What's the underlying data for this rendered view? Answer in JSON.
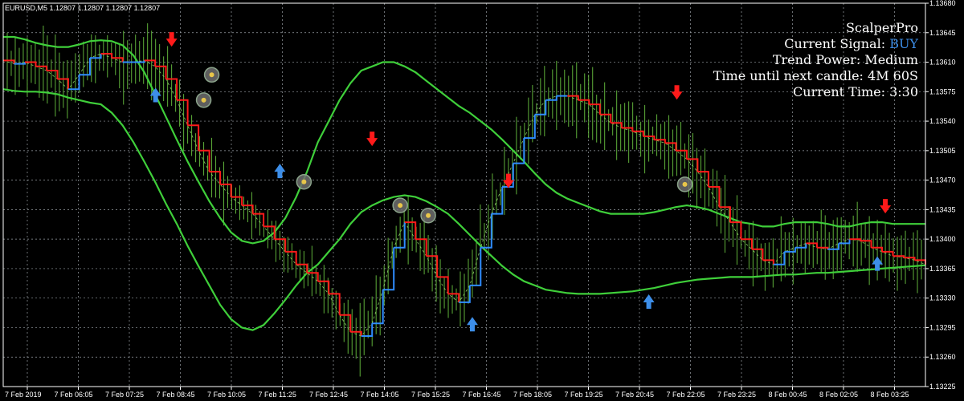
{
  "symbol_header": "EURUSD,M5  1.12807 1.12807 1.12807 1.12807",
  "info_panel": {
    "title": "ScalperPro",
    "signal_label": "Current Signal: ",
    "signal_value": "BUY",
    "trend_power": "Trend Power: Medium",
    "time_until": "Time until next candle: 4M 60S",
    "current_time": "Current Time: 3:30"
  },
  "colors": {
    "background": "#000000",
    "grid": "#9aa0a6",
    "candles": "#5fb03a",
    "bands": "#3fcf3a",
    "trend_up": "#2f8cff",
    "trend_down": "#ff1a1a",
    "signal_buy": "#3d8ee8",
    "arrow_up_small": "#a9d4ff",
    "arrow_down_small": "#e8163a",
    "axis_text": "#ffffff"
  },
  "chart_data": {
    "type": "line",
    "symbol": "EURUSD",
    "timeframe": "M5",
    "ylim": [
      1.13225,
      1.1368
    ],
    "y_ticks": [
      "1.13680",
      "1.13645",
      "1.13610",
      "1.13575",
      "1.13540",
      "1.13505",
      "1.13470",
      "1.13435",
      "1.13400",
      "1.13365",
      "1.13330",
      "1.13295",
      "1.13260",
      "1.13225"
    ],
    "x_ticks": [
      "7 Feb 2019",
      "7 Feb 06:05",
      "7 Feb 07:25",
      "7 Feb 08:45",
      "7 Feb 10:05",
      "7 Feb 11:25",
      "7 Feb 12:45",
      "7 Feb 14:05",
      "7 Feb 15:25",
      "7 Feb 16:45",
      "7 Feb 18:05",
      "7 Feb 19:25",
      "7 Feb 20:45",
      "7 Feb 22:05",
      "7 Feb 23:25",
      "8 Feb 00:45",
      "8 Feb 02:05",
      "8 Feb 03:25"
    ],
    "x": [
      0,
      10,
      20,
      30,
      40,
      50,
      60,
      70,
      80,
      90,
      100,
      110,
      120,
      130,
      140,
      150,
      160,
      170,
      180,
      190,
      200,
      210,
      220,
      230,
      240,
      250,
      260,
      270,
      280,
      290,
      300,
      310,
      320,
      330,
      340,
      350,
      360,
      370,
      380,
      390,
      400,
      410,
      420,
      430,
      440,
      450,
      460,
      470,
      480,
      490,
      500,
      510,
      520,
      530,
      540,
      550,
      560,
      570,
      580,
      590,
      600,
      610,
      620,
      630,
      640,
      650,
      660,
      670,
      680,
      690,
      700,
      710,
      720,
      730,
      740,
      750,
      760,
      770,
      780,
      790,
      800,
      810,
      820,
      830,
      840,
      850
    ],
    "series": [
      {
        "name": "",
        "role": "price",
        "values": [
          1.13612,
          1.13608,
          1.1361,
          1.13605,
          1.136,
          1.1359,
          1.13578,
          1.13595,
          1.13615,
          1.1362,
          1.13615,
          1.1361,
          1.1361,
          1.13612,
          1.13605,
          1.1359,
          1.13565,
          1.13535,
          1.13505,
          1.1348,
          1.13465,
          1.1345,
          1.1344,
          1.1343,
          1.13415,
          1.134,
          1.13385,
          1.1337,
          1.1336,
          1.1335,
          1.13335,
          1.1331,
          1.1329,
          1.13285,
          1.133,
          1.1334,
          1.1339,
          1.1342,
          1.134,
          1.1338,
          1.13355,
          1.13335,
          1.13325,
          1.13345,
          1.1339,
          1.1343,
          1.13462,
          1.1349,
          1.1352,
          1.13548,
          1.13565,
          1.1357,
          1.1357,
          1.13565,
          1.1356,
          1.13548,
          1.13538,
          1.13532,
          1.13528,
          1.13522,
          1.13518,
          1.13514,
          1.13505,
          1.13495,
          1.1348,
          1.13462,
          1.13438,
          1.1342,
          1.134,
          1.13388,
          1.13375,
          1.1337,
          1.13385,
          1.1339,
          1.13395,
          1.1339,
          1.13388,
          1.13395,
          1.134,
          1.13398,
          1.1339,
          1.13385,
          1.1338,
          1.13378,
          1.13375,
          1.1337
        ]
      },
      {
        "name": "",
        "role": "upper-band",
        "values": [
          1.1364,
          1.1364,
          1.13637,
          1.13633,
          1.1363,
          1.13628,
          1.13628,
          1.13631,
          1.13635,
          1.13636,
          1.13635,
          1.1363,
          1.13618,
          1.13598,
          1.13572,
          1.13545,
          1.13518,
          1.13492,
          1.13468,
          1.13445,
          1.13425,
          1.13408,
          1.13398,
          1.13395,
          1.13398,
          1.13408,
          1.13425,
          1.1345,
          1.1348,
          1.13515,
          1.1354,
          1.13565,
          1.13585,
          1.136,
          1.13605,
          1.1361,
          1.1361,
          1.13605,
          1.13598,
          1.13588,
          1.13578,
          1.13568,
          1.13558,
          1.1355,
          1.1354,
          1.1353,
          1.13518,
          1.13505,
          1.13492,
          1.13478,
          1.13465,
          1.13455,
          1.13448,
          1.13443,
          1.13438,
          1.13433,
          1.1343,
          1.1343,
          1.1343,
          1.1343,
          1.13432,
          1.13435,
          1.13438,
          1.1344,
          1.13438,
          1.13435,
          1.1343,
          1.13425,
          1.1342,
          1.13418,
          1.13415,
          1.13415,
          1.13418,
          1.1342,
          1.1342,
          1.1342,
          1.13418,
          1.13415,
          1.13415,
          1.13418,
          1.1342,
          1.1342,
          1.13418,
          1.13418,
          1.13418,
          1.13418
        ]
      },
      {
        "name": "",
        "role": "lower-band",
        "values": [
          1.13578,
          1.13576,
          1.13575,
          1.13575,
          1.13574,
          1.13572,
          1.13568,
          1.13565,
          1.13562,
          1.1356,
          1.1355,
          1.13535,
          1.13515,
          1.13492,
          1.13468,
          1.13442,
          1.13418,
          1.13392,
          1.13368,
          1.13345,
          1.13322,
          1.13305,
          1.13295,
          1.13292,
          1.13298,
          1.13312,
          1.13328,
          1.13345,
          1.1336,
          1.1337,
          1.13385,
          1.134,
          1.13418,
          1.13432,
          1.1344,
          1.13446,
          1.1345,
          1.13452,
          1.1345,
          1.13445,
          1.13438,
          1.1343,
          1.13418,
          1.13405,
          1.13392,
          1.1338,
          1.13368,
          1.13358,
          1.1335,
          1.13345,
          1.1334,
          1.13338,
          1.13336,
          1.13335,
          1.13335,
          1.13335,
          1.13336,
          1.13337,
          1.13338,
          1.1334,
          1.13342,
          1.13345,
          1.13348,
          1.1335,
          1.13352,
          1.13353,
          1.13354,
          1.13355,
          1.13355,
          1.13355,
          1.13356,
          1.13357,
          1.13358,
          1.13358,
          1.13359,
          1.1336,
          1.1336,
          1.13361,
          1.13362,
          1.13363,
          1.13364,
          1.13365,
          1.13366,
          1.13367,
          1.13368,
          1.13369
        ]
      }
    ],
    "signal_circles": [
      {
        "x": 52,
        "y": 1.13595
      },
      {
        "x": 50,
        "y": 1.13565
      },
      {
        "x": 75,
        "y": 1.13468
      },
      {
        "x": 99,
        "y": 1.1344
      },
      {
        "x": 106,
        "y": 1.13428
      },
      {
        "x": 170,
        "y": 1.13465
      }
    ],
    "buy_arrows": [
      {
        "x": 38,
        "y": 1.1357
      },
      {
        "x": 69,
        "y": 1.1348
      },
      {
        "x": 117,
        "y": 1.13298
      },
      {
        "x": 161,
        "y": 1.13325
      },
      {
        "x": 218,
        "y": 1.1337
      }
    ],
    "sell_arrows": [
      {
        "x": 42,
        "y": 1.13638
      },
      {
        "x": 92,
        "y": 1.1352
      },
      {
        "x": 126,
        "y": 1.1347
      },
      {
        "x": 168,
        "y": 1.13575
      },
      {
        "x": 220,
        "y": 1.1344
      }
    ],
    "xlim": [
      0,
      230
    ]
  }
}
